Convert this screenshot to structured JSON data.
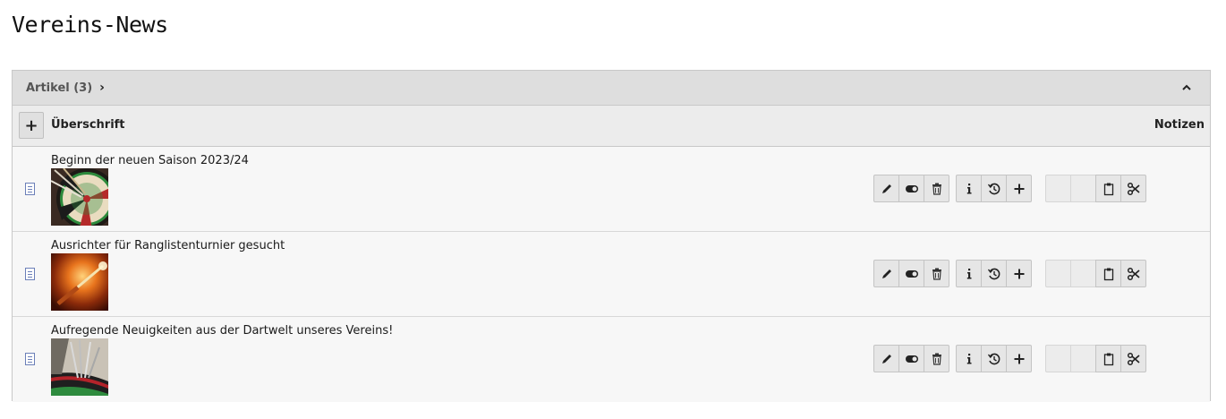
{
  "page": {
    "title": "Vereins-News"
  },
  "panel": {
    "header_label": "Artikel (3)",
    "columns": {
      "title": "Überschrift",
      "notes": "Notizen"
    },
    "new_button_label": "+"
  },
  "rows": [
    {
      "title": "Beginn der neuen Saison 2023/24",
      "thumb": "dartboard-arrows-image"
    },
    {
      "title": "Ausrichter für Ranglistenturnier gesucht",
      "thumb": "flying-dart-image"
    },
    {
      "title": "Aufregende Neuigkeiten aus der Dartwelt unseres Vereins!",
      "thumb": "darts-in-board-image"
    }
  ],
  "icons": {
    "edit": "pencil-icon",
    "toggle": "toggle-icon",
    "delete": "trash-icon",
    "info": "info-icon",
    "history": "history-icon",
    "add": "plus-icon",
    "paste": "clipboard-icon",
    "cut": "scissors-icon",
    "record": "document-icon"
  }
}
